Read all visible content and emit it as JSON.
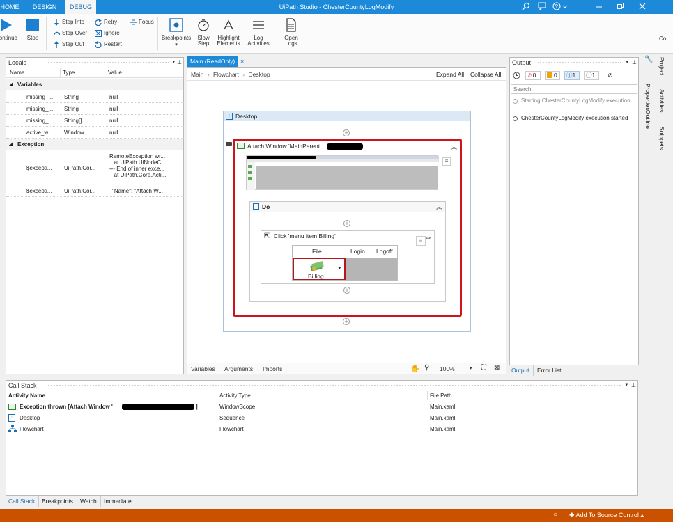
{
  "titlebar": {
    "title": "UiPath Studio - ChesterCountyLogModify",
    "tabs": [
      "HOME",
      "DESIGN",
      "DEBUG"
    ]
  },
  "ribbon": {
    "continue": "Continue",
    "stop": "Stop",
    "step_into": "Step Into",
    "step_over": "Step Over",
    "step_out": "Step Out",
    "retry": "Retry",
    "ignore": "Ignore",
    "restart": "Restart",
    "focus": "Focus",
    "breakpoints": "Breakpoints",
    "slow_step_1": "Slow",
    "slow_step_2": "Step",
    "highlight_1": "Highlight",
    "highlight_2": "Elements",
    "log_1": "Log",
    "log_2": "Activities",
    "open_logs_1": "Open",
    "open_logs_2": "Logs",
    "cut_label": "Co"
  },
  "locals": {
    "title": "Locals",
    "headers": [
      "Name",
      "Type",
      "Value"
    ],
    "variables_label": "Variables",
    "variables": [
      {
        "name": "missing_...",
        "type": "String",
        "value": "null"
      },
      {
        "name": "missing_...",
        "type": "String",
        "value": "null"
      },
      {
        "name": "missing_...",
        "type": "String[]",
        "value": "null"
      },
      {
        "name": "active_w...",
        "type": "Window",
        "value": "null"
      }
    ],
    "exception_label": "Exception",
    "exceptions": [
      {
        "name": "$excepti...",
        "type": "UiPath.Cor...",
        "value_lines": [
          "RemoteException wr...",
          "   at UiPath.UiNodeC...",
          "--- End of inner exce...",
          "   at UiPath.Core.Acti..."
        ]
      },
      {
        "name": "$excepti...",
        "type": "UiPath.Cor...",
        "value_lines": [
          "\"Name\": \"Attach W..."
        ]
      }
    ]
  },
  "designer": {
    "tab": "Main (ReadOnly)",
    "breadcrumb": [
      "Main",
      "Flowchart",
      "Desktop"
    ],
    "expand_all": "Expand All",
    "collapse_all": "Collapse All",
    "sequence_title": "Desktop",
    "attach_title": "Attach Window 'MainParent",
    "do_title": "Do",
    "click_title": "Click 'menu item  Billing'",
    "menu": {
      "file": "File",
      "login": "Login",
      "logoff": "Logoff",
      "billing": "Billing"
    },
    "bottom_tabs": [
      "Variables",
      "Arguments",
      "Imports"
    ],
    "zoom": "100%"
  },
  "output": {
    "title": "Output",
    "badges": [
      "0",
      "0",
      "1",
      "1"
    ],
    "search_placeholder": "Search",
    "messages": [
      {
        "text": "Starting ChesterCountyLogModify execution.",
        "gray": true
      },
      {
        "text": "ChesterCountyLogModify execution started",
        "gray": false
      }
    ],
    "tabs": [
      "Output",
      "Error List"
    ]
  },
  "side_tabs": [
    "Project",
    "Properties",
    "Activities",
    "Outline",
    "Snippets"
  ],
  "callstack": {
    "title": "Call Stack",
    "headers": [
      "Activity Name",
      "Activity Type",
      "File Path"
    ],
    "rows": [
      {
        "name": "Exception thrown [Attach Window '",
        "suffix": "]",
        "type": "WindowScope",
        "path": "Main.xaml",
        "bold": true
      },
      {
        "name": "Desktop",
        "suffix": "",
        "type": "Sequence",
        "path": "Main.xaml",
        "bold": false
      },
      {
        "name": "Flowchart",
        "suffix": "",
        "type": "Flowchart",
        "path": "Main.xaml",
        "bold": false
      }
    ],
    "tabs": [
      "Call Stack",
      "Breakpoints",
      "Watch",
      "Immediate"
    ]
  },
  "statusbar": {
    "source_control": "Add To Source Control",
    "color": "#ca5100"
  }
}
